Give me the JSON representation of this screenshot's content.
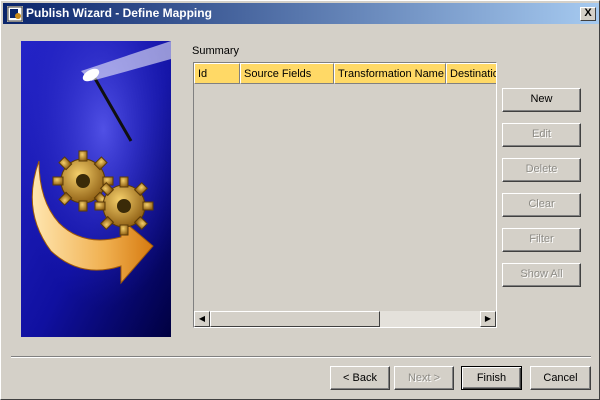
{
  "window": {
    "title": "Publish Wizard - Define Mapping",
    "close_glyph": "X"
  },
  "summary": {
    "label": "Summary",
    "columns": [
      "Id",
      "Source Fields",
      "Transformation Name",
      "Destination"
    ]
  },
  "side_buttons": {
    "new": "New",
    "edit": "Edit",
    "delete": "Delete",
    "clear": "Clear",
    "filter": "Filter",
    "show_all": "Show All"
  },
  "nav_buttons": {
    "back": "< Back",
    "next": "Next >",
    "finish": "Finish",
    "cancel": "Cancel"
  },
  "icons": {
    "app": "wizard-icon",
    "art": "gears-arrow-wand-illustration",
    "scroll_left": "arrow-left-icon",
    "scroll_right": "arrow-right-icon"
  },
  "colors": {
    "title_gradient_start": "#0a246a",
    "title_gradient_end": "#a6caf0",
    "header_fill": "#ffd966",
    "face": "#d4d0c8"
  }
}
